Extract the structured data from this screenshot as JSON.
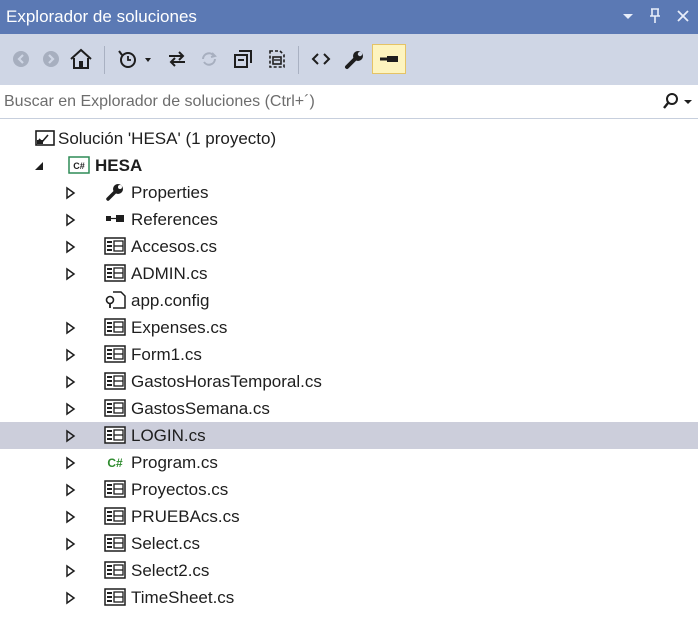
{
  "window": {
    "title": "Explorador de soluciones",
    "pin_glyph": "ᵖ",
    "accent": "#5b79b4"
  },
  "toolbar": {
    "buttons": [
      {
        "name": "back-icon"
      },
      {
        "name": "forward-icon"
      },
      {
        "name": "home-icon"
      },
      {
        "name": "pending-changes-filter-icon"
      },
      {
        "name": "sync-active-document-icon"
      },
      {
        "name": "refresh-icon"
      },
      {
        "name": "collapse-all-icon"
      },
      {
        "name": "show-all-files-icon"
      },
      {
        "name": "view-code-icon"
      },
      {
        "name": "properties-icon"
      },
      {
        "name": "preview-selected-items-icon"
      }
    ]
  },
  "search": {
    "placeholder": "Buscar en Explorador de soluciones (Ctrl+´)"
  },
  "tree": {
    "solution": "Solución 'HESA'  (1 proyecto)",
    "project": "HESA",
    "items": [
      {
        "label": "Properties",
        "icon": "wrench-icon",
        "expandable": true
      },
      {
        "label": "References",
        "icon": "references-icon",
        "expandable": true
      },
      {
        "label": "Accesos.cs",
        "icon": "form-icon",
        "expandable": true
      },
      {
        "label": "ADMIN.cs",
        "icon": "form-icon",
        "expandable": true
      },
      {
        "label": "app.config",
        "icon": "config-icon",
        "expandable": false
      },
      {
        "label": "Expenses.cs",
        "icon": "form-icon",
        "expandable": true
      },
      {
        "label": "Form1.cs",
        "icon": "form-icon",
        "expandable": true
      },
      {
        "label": "GastosHorasTemporal.cs",
        "icon": "form-icon",
        "expandable": true
      },
      {
        "label": "GastosSemana.cs",
        "icon": "form-icon",
        "expandable": true
      },
      {
        "label": "LOGIN.cs",
        "icon": "form-icon",
        "expandable": true,
        "selected": true
      },
      {
        "label": "Program.cs",
        "icon": "csharp-file-icon",
        "expandable": true
      },
      {
        "label": "Proyectos.cs",
        "icon": "form-icon",
        "expandable": true
      },
      {
        "label": "PRUEBAcs.cs",
        "icon": "form-icon",
        "expandable": true
      },
      {
        "label": "Select.cs",
        "icon": "form-icon",
        "expandable": true
      },
      {
        "label": "Select2.cs",
        "icon": "form-icon",
        "expandable": true
      },
      {
        "label": "TimeSheet.cs",
        "icon": "form-icon",
        "expandable": true
      }
    ]
  }
}
